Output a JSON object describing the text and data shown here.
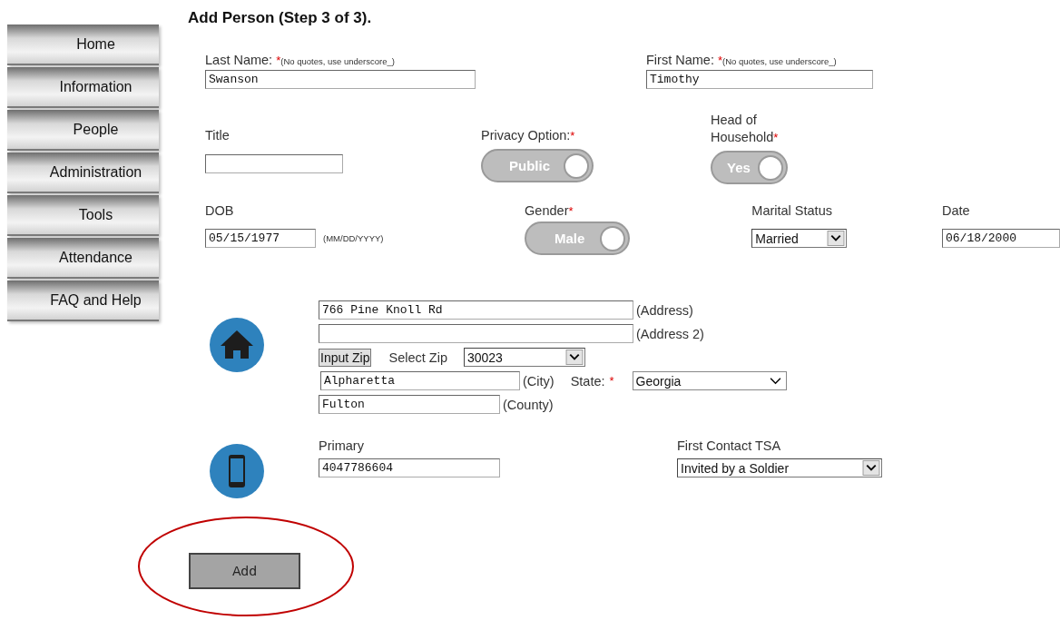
{
  "sidebar": {
    "items": [
      {
        "label": "Home"
      },
      {
        "label": "Information"
      },
      {
        "label": "People"
      },
      {
        "label": "Administration"
      },
      {
        "label": "Tools"
      },
      {
        "label": "Attendance"
      },
      {
        "label": "FAQ and Help"
      }
    ]
  },
  "form": {
    "title": "Add Person (Step 3 of 3).",
    "last_name": {
      "label": "Last Name:",
      "required_mark": "*",
      "hint": "(No quotes, use underscore_)",
      "value": "Swanson"
    },
    "first_name": {
      "label": "First Name:",
      "required_mark": "*",
      "hint": "(No quotes, use underscore_)",
      "value": "Timothy"
    },
    "title_field": {
      "label": "Title"
    },
    "privacy": {
      "label": "Privacy Option:",
      "required_mark": "*",
      "value": "Public",
      "on": true
    },
    "head_of_household": {
      "label": "Head of Household",
      "required_mark": "*",
      "value": "Yes",
      "on": true
    },
    "dob": {
      "label": "DOB",
      "value": "05/15/1977",
      "hint": "(MM/DD/YYYY)"
    },
    "gender": {
      "label": "Gender",
      "required_mark": "*",
      "value": "Male",
      "on": true
    },
    "marital_status": {
      "label": "Marital Status",
      "value": "Married"
    },
    "date": {
      "label": "Date",
      "value": "06/18/2000"
    },
    "address": {
      "value": "766 Pine Knoll Rd",
      "suffix": "(Address)"
    },
    "address2": {
      "suffix": "(Address 2)"
    },
    "input_zip": {
      "label": "Input Zip"
    },
    "select_zip": {
      "label": "Select Zip",
      "value": "30023"
    },
    "city": {
      "value": "Alpharetta",
      "suffix": "(City)"
    },
    "state": {
      "label": "State:",
      "required_mark": "*",
      "value": "Georgia"
    },
    "county": {
      "value": "Fulton",
      "suffix": "(County)"
    },
    "primary": {
      "label": "Primary",
      "value": "4047786604"
    },
    "first_contact": {
      "label": "First Contact TSA",
      "value": "Invited by a Soldier"
    },
    "add_button": {
      "label": "Add"
    }
  },
  "annotation": {
    "kind": "ellipse"
  }
}
